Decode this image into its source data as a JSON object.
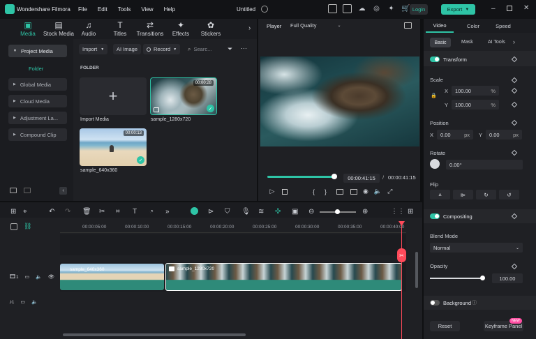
{
  "app": {
    "name": "Wondershare Filmora",
    "project": "Untitled"
  },
  "menu": [
    "File",
    "Edit",
    "Tools",
    "View",
    "Help"
  ],
  "top_buttons": {
    "login": "Login",
    "export": "Export"
  },
  "toolbar": [
    {
      "label": "Media",
      "icon": "media-icon"
    },
    {
      "label": "Stock Media",
      "icon": "stock-media-icon"
    },
    {
      "label": "Audio",
      "icon": "audio-icon"
    },
    {
      "label": "Titles",
      "icon": "titles-icon"
    },
    {
      "label": "Transitions",
      "icon": "transitions-icon"
    },
    {
      "label": "Effects",
      "icon": "effects-icon"
    },
    {
      "label": "Stickers",
      "icon": "stickers-icon"
    }
  ],
  "sidebar": {
    "items": [
      "Project Media",
      "Folder",
      "Global Media",
      "Cloud Media",
      "Adjustment La...",
      "Compound Clip"
    ]
  },
  "media_toolbar": {
    "import": "Import",
    "ai_image": "AI Image",
    "record": "Record",
    "search_placeholder": "Searc..."
  },
  "media": {
    "folder_label": "FOLDER",
    "import_label": "Import Media",
    "items": [
      {
        "name": "sample_1280x720",
        "duration": "00:00:28"
      },
      {
        "name": "sample_640x360",
        "duration": "00:00:13"
      }
    ]
  },
  "player": {
    "label": "Player",
    "quality": "Full Quality",
    "current": "00:00:41:15",
    "total": "00:00:41:15",
    "progress": 1.0
  },
  "inspector": {
    "tabs": [
      "Video",
      "Color",
      "Speed"
    ],
    "subtabs": [
      "Basic",
      "Mask",
      "AI Tools"
    ],
    "transform": "Transform",
    "scale": {
      "label": "Scale",
      "x_label": "X",
      "x": "100.00",
      "y_label": "Y",
      "y": "100.00",
      "unit": "%"
    },
    "position": {
      "label": "Position",
      "x_label": "X",
      "x": "0.00",
      "y_label": "Y",
      "y": "0.00",
      "unit": "px"
    },
    "rotate": {
      "label": "Rotate",
      "value": "0.00°"
    },
    "flip": "Flip",
    "compositing": "Compositing",
    "blend_mode": {
      "label": "Blend Mode",
      "value": "Normal"
    },
    "opacity": {
      "label": "Opacity",
      "value": "100.00",
      "level": 1.0
    },
    "background": "Background",
    "reset": "Reset",
    "keyframe": "Keyframe Panel",
    "new_badge": "NEW"
  },
  "timeline": {
    "ticks": [
      "00:00:05:00",
      "00:00:10:00",
      "00:00:15:00",
      "00:00:20:00",
      "00:00:25:00",
      "00:00:30:00",
      "00:00:35:00",
      "00:00:40:00"
    ],
    "clips": [
      {
        "name": "sample_640x360"
      },
      {
        "name": "sample_1280x720"
      }
    ],
    "video_track": "1",
    "audio_track": "1"
  },
  "colors": {
    "accent": "#2ec4a6",
    "playhead": "#ff4a5a",
    "export": "#2ec4a6"
  }
}
